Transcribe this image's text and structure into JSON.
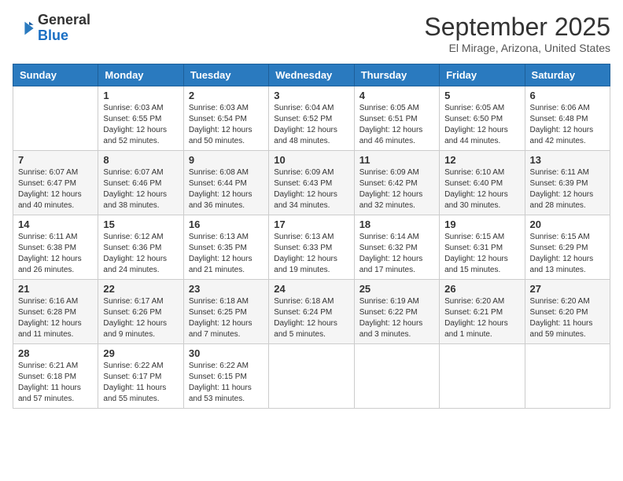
{
  "logo": {
    "general": "General",
    "blue": "Blue"
  },
  "header": {
    "month": "September 2025",
    "location": "El Mirage, Arizona, United States"
  },
  "days_of_week": [
    "Sunday",
    "Monday",
    "Tuesday",
    "Wednesday",
    "Thursday",
    "Friday",
    "Saturday"
  ],
  "weeks": [
    [
      {
        "day": "",
        "sunrise": "",
        "sunset": "",
        "daylight": ""
      },
      {
        "day": "1",
        "sunrise": "6:03 AM",
        "sunset": "6:55 PM",
        "daylight": "12 hours and 52 minutes."
      },
      {
        "day": "2",
        "sunrise": "6:03 AM",
        "sunset": "6:54 PM",
        "daylight": "12 hours and 50 minutes."
      },
      {
        "day": "3",
        "sunrise": "6:04 AM",
        "sunset": "6:52 PM",
        "daylight": "12 hours and 48 minutes."
      },
      {
        "day": "4",
        "sunrise": "6:05 AM",
        "sunset": "6:51 PM",
        "daylight": "12 hours and 46 minutes."
      },
      {
        "day": "5",
        "sunrise": "6:05 AM",
        "sunset": "6:50 PM",
        "daylight": "12 hours and 44 minutes."
      },
      {
        "day": "6",
        "sunrise": "6:06 AM",
        "sunset": "6:48 PM",
        "daylight": "12 hours and 42 minutes."
      }
    ],
    [
      {
        "day": "7",
        "sunrise": "6:07 AM",
        "sunset": "6:47 PM",
        "daylight": "12 hours and 40 minutes."
      },
      {
        "day": "8",
        "sunrise": "6:07 AM",
        "sunset": "6:46 PM",
        "daylight": "12 hours and 38 minutes."
      },
      {
        "day": "9",
        "sunrise": "6:08 AM",
        "sunset": "6:44 PM",
        "daylight": "12 hours and 36 minutes."
      },
      {
        "day": "10",
        "sunrise": "6:09 AM",
        "sunset": "6:43 PM",
        "daylight": "12 hours and 34 minutes."
      },
      {
        "day": "11",
        "sunrise": "6:09 AM",
        "sunset": "6:42 PM",
        "daylight": "12 hours and 32 minutes."
      },
      {
        "day": "12",
        "sunrise": "6:10 AM",
        "sunset": "6:40 PM",
        "daylight": "12 hours and 30 minutes."
      },
      {
        "day": "13",
        "sunrise": "6:11 AM",
        "sunset": "6:39 PM",
        "daylight": "12 hours and 28 minutes."
      }
    ],
    [
      {
        "day": "14",
        "sunrise": "6:11 AM",
        "sunset": "6:38 PM",
        "daylight": "12 hours and 26 minutes."
      },
      {
        "day": "15",
        "sunrise": "6:12 AM",
        "sunset": "6:36 PM",
        "daylight": "12 hours and 24 minutes."
      },
      {
        "day": "16",
        "sunrise": "6:13 AM",
        "sunset": "6:35 PM",
        "daylight": "12 hours and 21 minutes."
      },
      {
        "day": "17",
        "sunrise": "6:13 AM",
        "sunset": "6:33 PM",
        "daylight": "12 hours and 19 minutes."
      },
      {
        "day": "18",
        "sunrise": "6:14 AM",
        "sunset": "6:32 PM",
        "daylight": "12 hours and 17 minutes."
      },
      {
        "day": "19",
        "sunrise": "6:15 AM",
        "sunset": "6:31 PM",
        "daylight": "12 hours and 15 minutes."
      },
      {
        "day": "20",
        "sunrise": "6:15 AM",
        "sunset": "6:29 PM",
        "daylight": "12 hours and 13 minutes."
      }
    ],
    [
      {
        "day": "21",
        "sunrise": "6:16 AM",
        "sunset": "6:28 PM",
        "daylight": "12 hours and 11 minutes."
      },
      {
        "day": "22",
        "sunrise": "6:17 AM",
        "sunset": "6:26 PM",
        "daylight": "12 hours and 9 minutes."
      },
      {
        "day": "23",
        "sunrise": "6:18 AM",
        "sunset": "6:25 PM",
        "daylight": "12 hours and 7 minutes."
      },
      {
        "day": "24",
        "sunrise": "6:18 AM",
        "sunset": "6:24 PM",
        "daylight": "12 hours and 5 minutes."
      },
      {
        "day": "25",
        "sunrise": "6:19 AM",
        "sunset": "6:22 PM",
        "daylight": "12 hours and 3 minutes."
      },
      {
        "day": "26",
        "sunrise": "6:20 AM",
        "sunset": "6:21 PM",
        "daylight": "12 hours and 1 minute."
      },
      {
        "day": "27",
        "sunrise": "6:20 AM",
        "sunset": "6:20 PM",
        "daylight": "11 hours and 59 minutes."
      }
    ],
    [
      {
        "day": "28",
        "sunrise": "6:21 AM",
        "sunset": "6:18 PM",
        "daylight": "11 hours and 57 minutes."
      },
      {
        "day": "29",
        "sunrise": "6:22 AM",
        "sunset": "6:17 PM",
        "daylight": "11 hours and 55 minutes."
      },
      {
        "day": "30",
        "sunrise": "6:22 AM",
        "sunset": "6:15 PM",
        "daylight": "11 hours and 53 minutes."
      },
      {
        "day": "",
        "sunrise": "",
        "sunset": "",
        "daylight": ""
      },
      {
        "day": "",
        "sunrise": "",
        "sunset": "",
        "daylight": ""
      },
      {
        "day": "",
        "sunrise": "",
        "sunset": "",
        "daylight": ""
      },
      {
        "day": "",
        "sunrise": "",
        "sunset": "",
        "daylight": ""
      }
    ]
  ]
}
